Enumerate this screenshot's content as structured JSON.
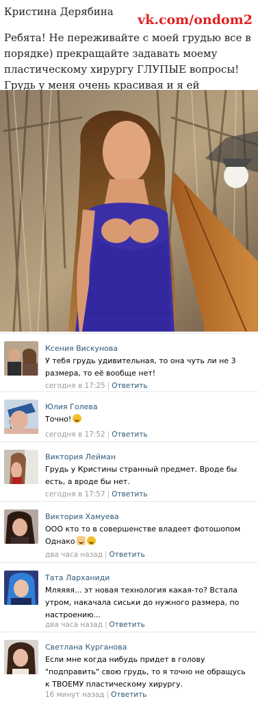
{
  "post": {
    "author": "Кристина Дерябина",
    "watermark": "vk.com/ondom2",
    "text": "Ребята! Не переживайте с моей грудью все в порядке) прекращайте задавать моему пластическому хирургу ГЛУПЫЕ вопросы! Грудь у меня очень красивая и я ей довольна! Спасибо лучшему хирургу"
  },
  "comments": [
    {
      "name": "Ксения Вискунова",
      "text": "У тебя грудь удивительная, то она чуть ли не 3 размера, то её вообще нет!",
      "time": "сегодня в 17:25",
      "reply": "Ответить"
    },
    {
      "name": "Юлия Голева",
      "text": "Точно!",
      "time": "сегодня в 17:52",
      "reply": "Ответить"
    },
    {
      "name": "Виктория Лейман",
      "text": "Грудь у Кристины странный предмет. Вроде бы есть, а вроде бы нет.",
      "time": "сегодня в 17:57",
      "reply": "Ответить"
    },
    {
      "name": "Виктория Хамуева",
      "text1": "ООО кто то в совершенстве владеет фотошопом",
      "text2": "Однако",
      "time": "два часа назад",
      "reply": "Ответить"
    },
    {
      "name": "Тата Ларханиди",
      "text": "Мляяяя... эт новая технология какая-то? Встала утром, накачала сиськи до нужного размера, по настроению...",
      "time": "два часа назад",
      "reply": "Ответить"
    },
    {
      "name": "Светлана Курганова",
      "text": "Если мне когда нибудь придет в голову \"подправить\" свою грудь, то я точно не обращусь к ТВОЕМУ пластическому хирургу.",
      "time": "16 минут назад",
      "reply": "Ответить"
    }
  ]
}
